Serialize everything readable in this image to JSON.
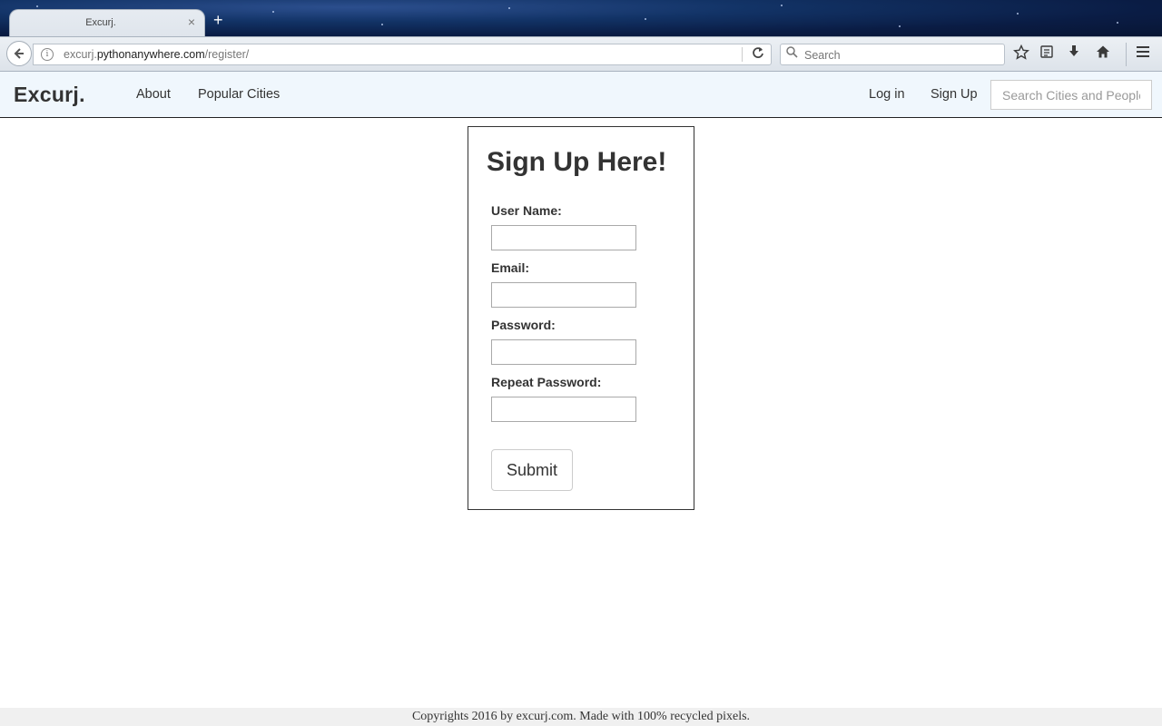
{
  "browser": {
    "tab_title": "Excurj.",
    "tab_close": "×",
    "new_tab": "+",
    "url_host_prefix": "excurj.",
    "url_host_main": "pythonanywhere.com",
    "url_path": "/register/",
    "search_placeholder": "Search"
  },
  "site_nav": {
    "brand": "Excurj.",
    "links": [
      "About",
      "Popular Cities"
    ],
    "login": "Log in",
    "signup": "Sign Up",
    "search_placeholder": "Search Cities and People"
  },
  "form": {
    "heading": "Sign Up Here!",
    "fields": [
      {
        "label": "User Name:",
        "value": ""
      },
      {
        "label": "Email:",
        "value": ""
      },
      {
        "label": "Password:",
        "value": ""
      },
      {
        "label": "Repeat Password:",
        "value": ""
      }
    ],
    "submit_label": "Submit"
  },
  "footer": {
    "text": "Copyrights 2016 by excurj.com. Made with 100% recycled pixels."
  }
}
